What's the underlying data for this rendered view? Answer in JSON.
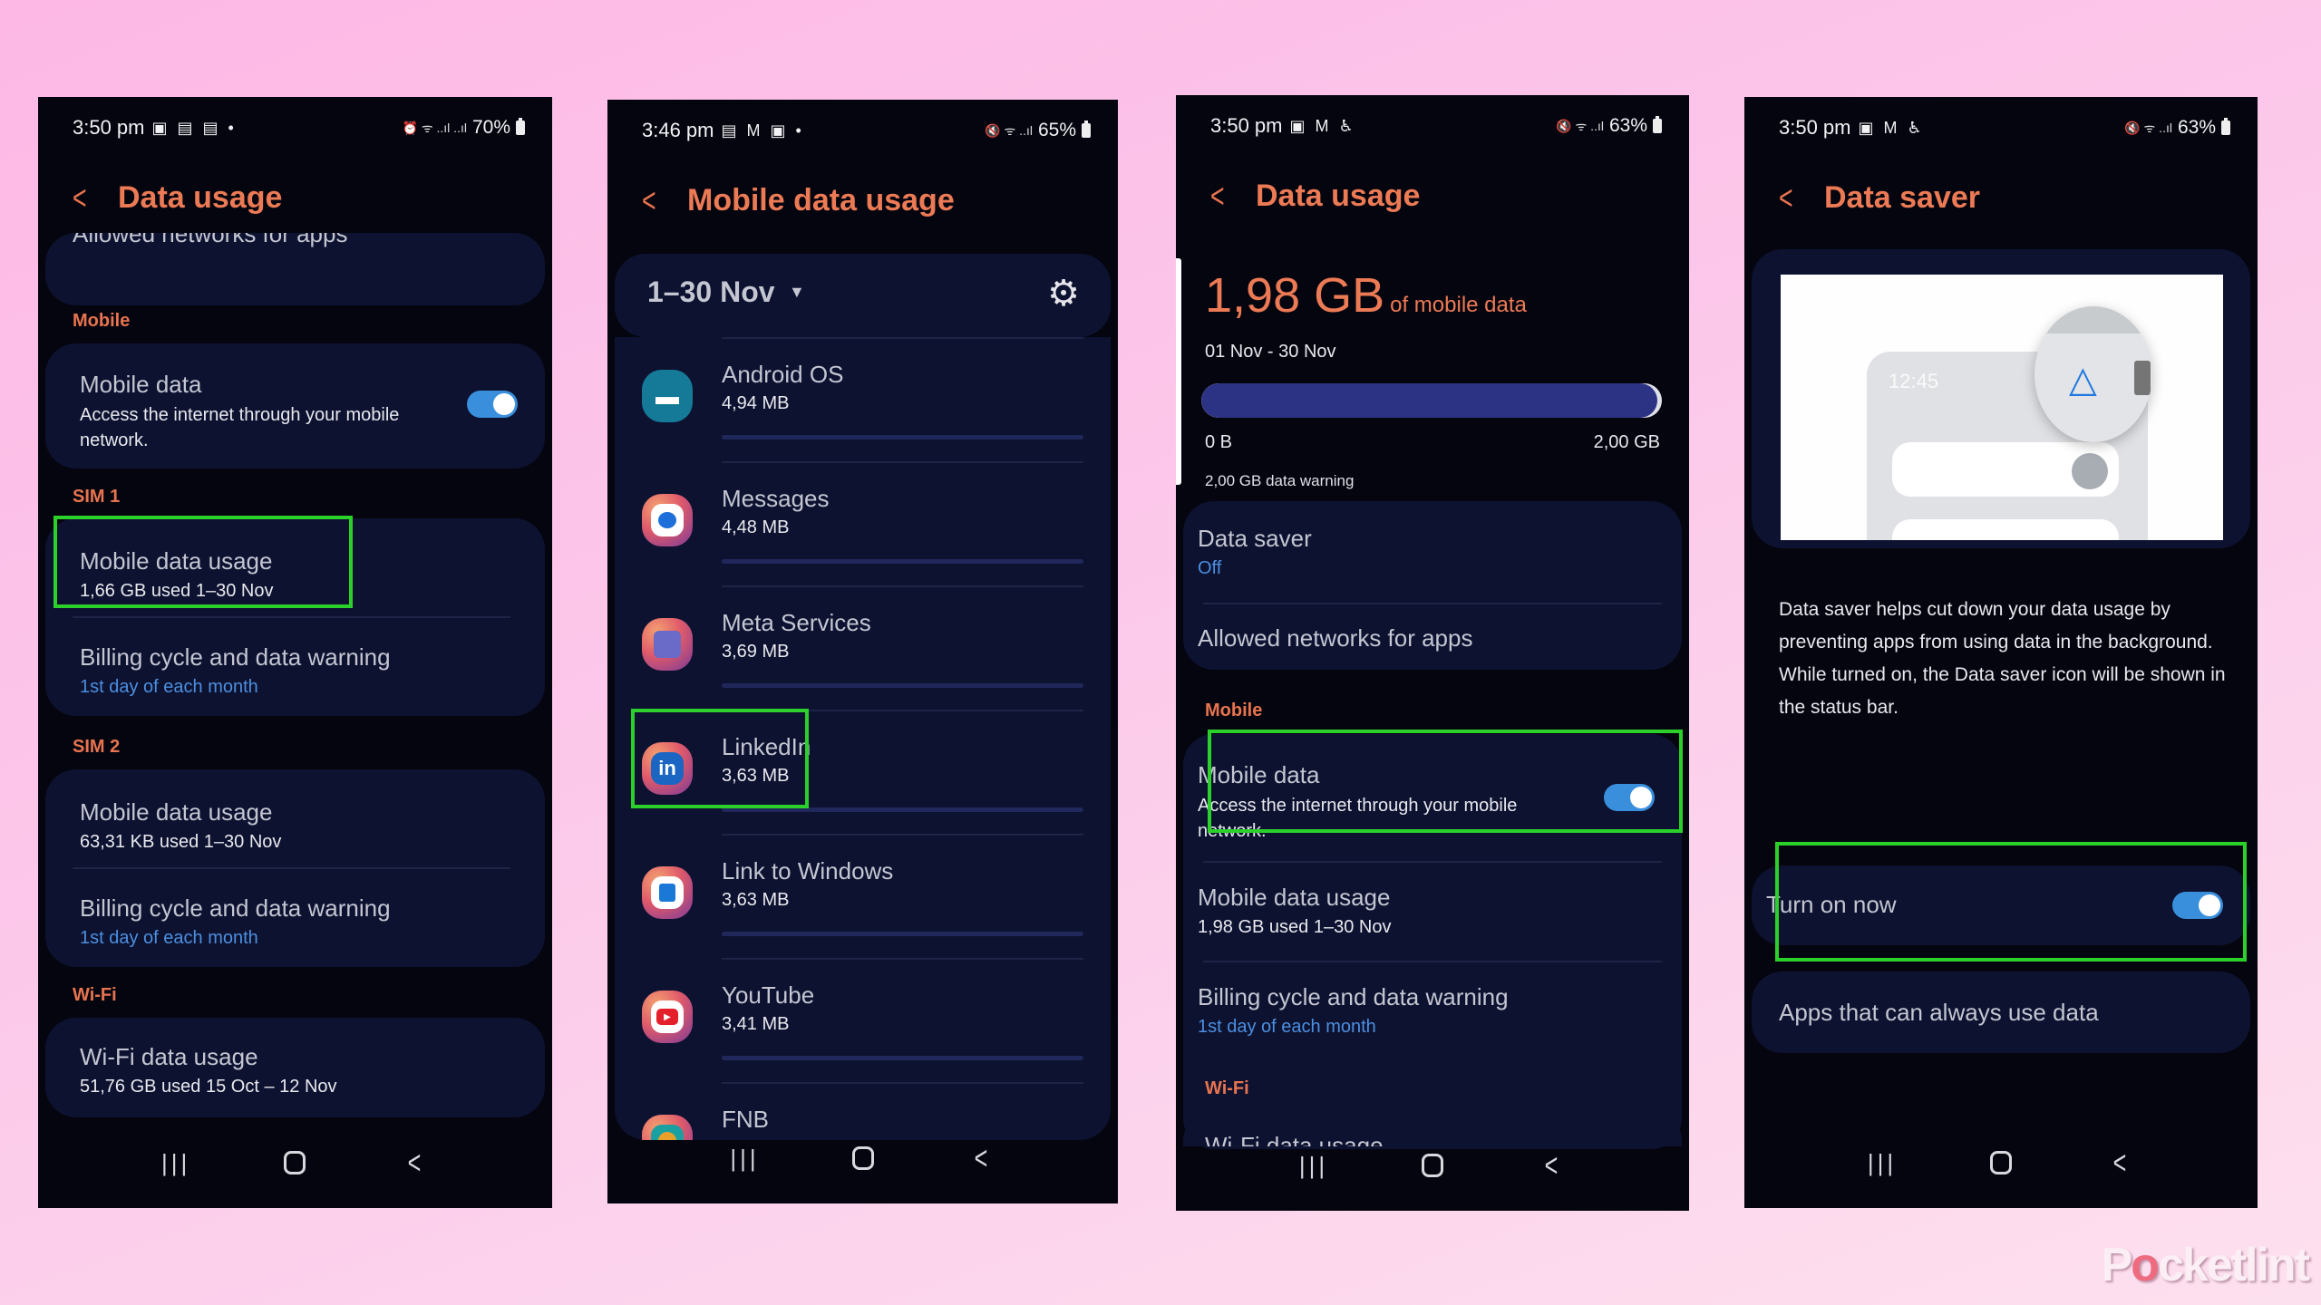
{
  "colors": {
    "accent_orange": "#ec7a55",
    "link_blue": "#4c8fe0",
    "toggle_on": "#3a8fdc",
    "highlight_green": "#2bd02b",
    "card_bg": "#0d1230",
    "screen_bg": "#05050f"
  },
  "nav_icons": [
    "recents-icon",
    "home-icon",
    "back-icon"
  ],
  "panels": [
    {
      "status": {
        "time": "3:50 pm",
        "icons": "▣ ▤ ▤ •",
        "right_icons": "⏰ ᯤ ..ıl ..ıl",
        "battery": "70%"
      },
      "title": "Data usage",
      "clipped_item": "Allowed networks for apps",
      "sections": {
        "mobile": "Mobile",
        "sim1": "SIM 1",
        "sim2": "SIM 2",
        "wifi": "Wi-Fi"
      },
      "mobile_data": {
        "title": "Mobile data",
        "subtitle": "Access the internet through your mobile network.",
        "toggle_on": true
      },
      "sim1": [
        {
          "title": "Mobile data usage",
          "subtitle": "1,66 GB used 1–30 Nov"
        },
        {
          "title": "Billing cycle and data warning",
          "subtitle": "1st day of each month"
        }
      ],
      "sim2": [
        {
          "title": "Mobile data usage",
          "subtitle": "63,31 KB used 1–30 Nov"
        },
        {
          "title": "Billing cycle and data warning",
          "subtitle": "1st day of each month"
        }
      ],
      "wifi": [
        {
          "title": "Wi-Fi data usage",
          "subtitle": "51,76 GB used 15 Oct – 12 Nov"
        }
      ]
    },
    {
      "status": {
        "time": "3:46 pm",
        "icons": "▤ M ▣ •",
        "right_icons": "🔇 ᯤ ..ıl",
        "battery": "65%"
      },
      "title": "Mobile data usage",
      "date_range": "1–30 Nov",
      "apps": [
        {
          "name": "Android OS",
          "size": "4,94 MB",
          "icon": "android-icon"
        },
        {
          "name": "Messages",
          "size": "4,48 MB",
          "icon": "messages-icon"
        },
        {
          "name": "Meta Services",
          "size": "3,69 MB",
          "icon": "meta-services-icon"
        },
        {
          "name": "LinkedIn",
          "size": "3,63 MB",
          "icon": "linkedin-icon",
          "icon_text": "in"
        },
        {
          "name": "Link to Windows",
          "size": "3,63 MB",
          "icon": "link-to-windows-icon"
        },
        {
          "name": "YouTube",
          "size": "3,41 MB",
          "icon": "youtube-icon"
        },
        {
          "name": "FNB",
          "size": "",
          "icon": "fnb-icon"
        }
      ]
    },
    {
      "status": {
        "time": "3:50 pm",
        "icons": "▣ M ♿",
        "right_icons": "🔇 ᯤ ..ıl",
        "battery": "63%"
      },
      "title": "Data usage",
      "usage": {
        "amount": "1,98 GB",
        "unit_label": "of mobile data",
        "range": "01 Nov - 30 Nov",
        "bar_min": "0 B",
        "bar_max": "2,00 GB",
        "fraction_used": 0.99,
        "warning": "2,00 GB data warning"
      },
      "data_saver": {
        "title": "Data saver",
        "subtitle": "Off"
      },
      "allowed_networks": "Allowed networks for apps",
      "section_mobile": "Mobile",
      "mobile_data": {
        "title": "Mobile data",
        "subtitle": "Access the internet through your mobile network.",
        "toggle_on": true
      },
      "mobile_data_usage": {
        "title": "Mobile data usage",
        "subtitle": "1,98 GB used 1–30 Nov"
      },
      "billing": {
        "title": "Billing cycle and data warning",
        "subtitle": "1st day of each month"
      },
      "section_wifi": "Wi-Fi",
      "clipped_item": "Wi-Fi data usage"
    },
    {
      "status": {
        "time": "3:50 pm",
        "icons": "▣ M ♿",
        "right_icons": "🔇 ᯤ ..ıl",
        "battery": "63%"
      },
      "title": "Data saver",
      "illustration": {
        "clock": "12:45"
      },
      "description": "Data saver helps cut down your data usage by preventing apps from using data in the background. While turned on, the Data saver icon will be shown in the status bar.",
      "turn_on": {
        "label": "Turn on now",
        "toggle_on": true
      },
      "apps_always": "Apps that can always use data"
    }
  ],
  "watermark": {
    "prefix": "P",
    "o": "o",
    "suffix": "cketlint"
  }
}
